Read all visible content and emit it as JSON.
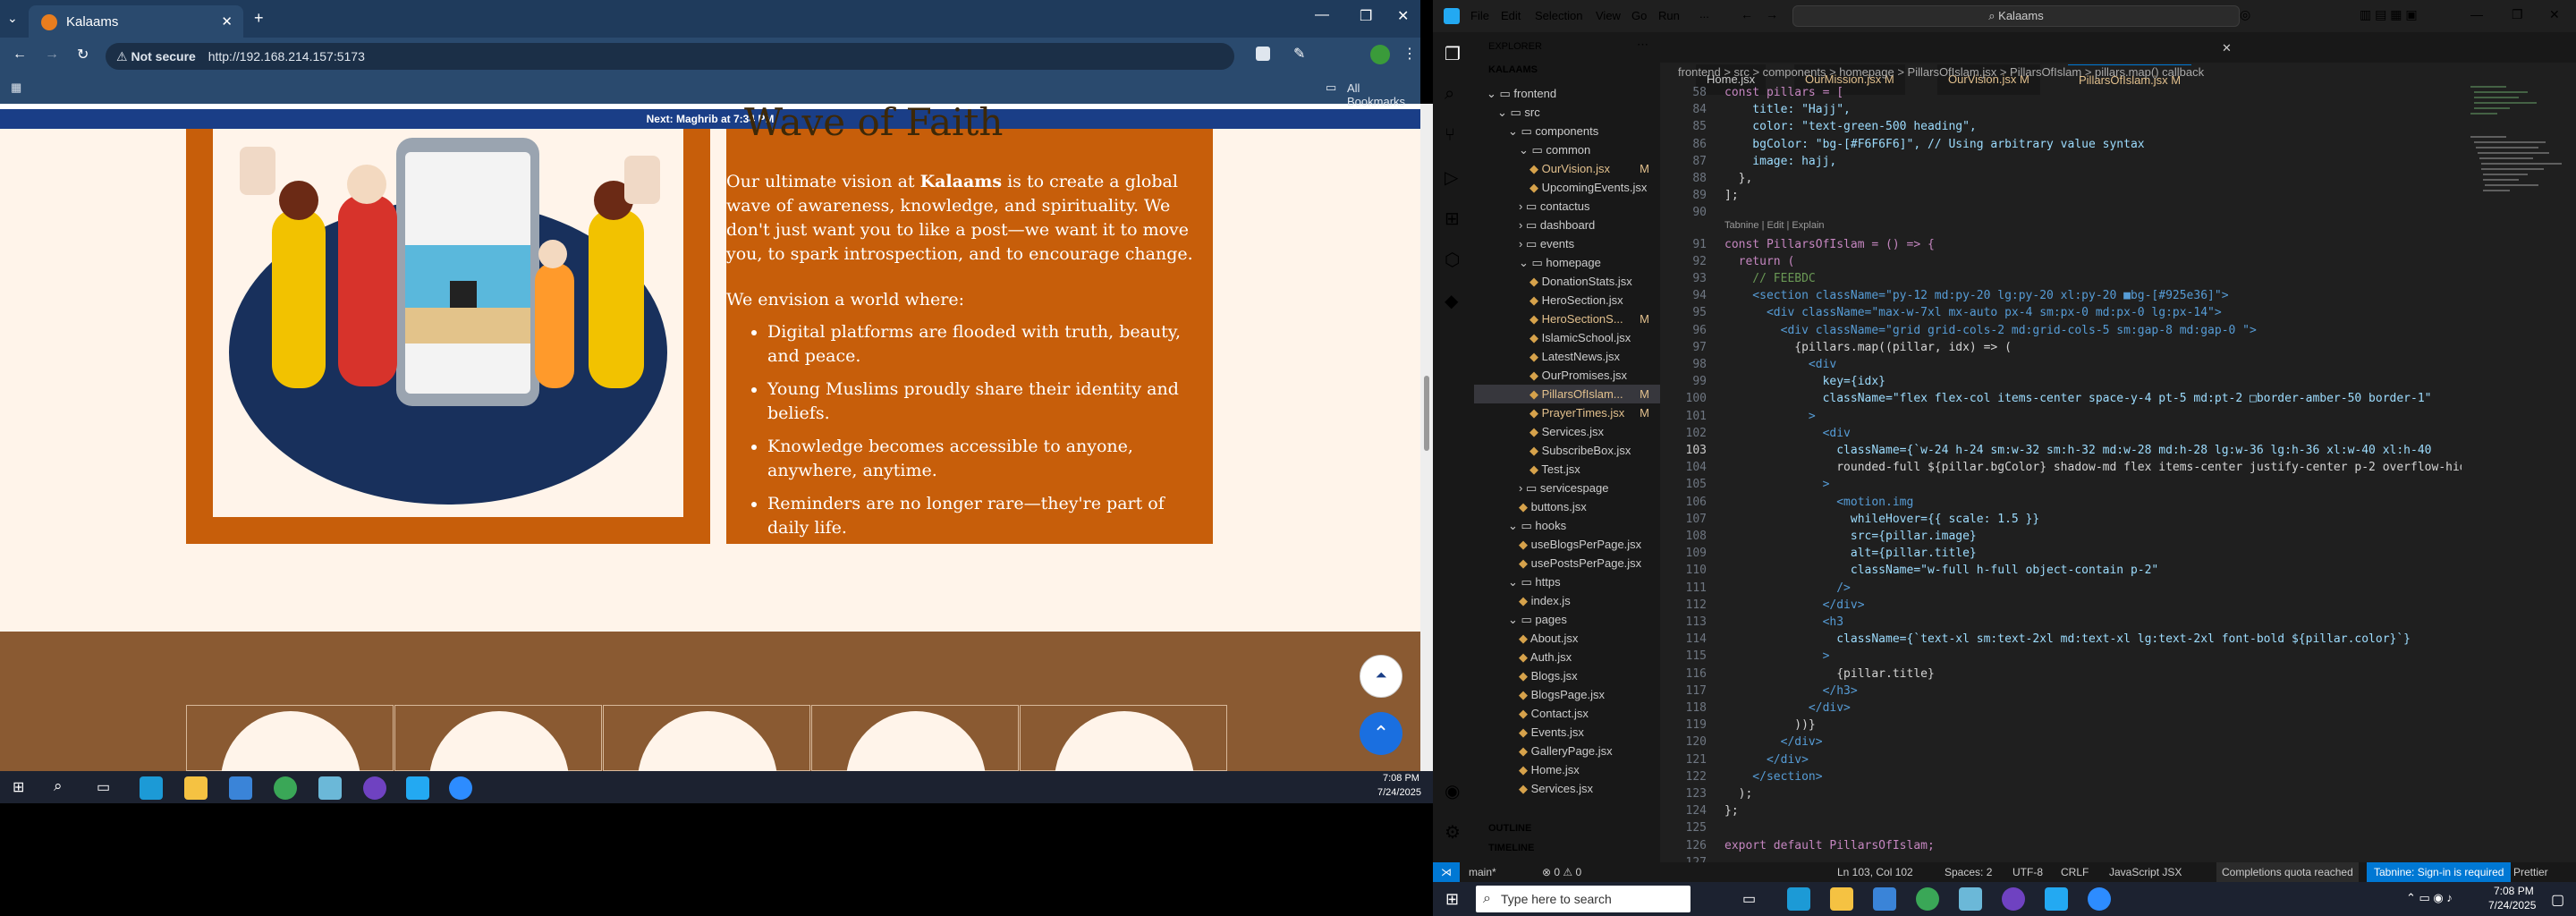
{
  "browser": {
    "tab_title": "Kalaams",
    "url_not_secure": "Not secure",
    "url": "http://192.168.214.157:5173",
    "all_bookmarks": "All Bookmarks",
    "next_prayer": "Next: Maghrib at 7:34 PM"
  },
  "site": {
    "heading_partial": "Wave of Faith",
    "para1_pre": "Our ultimate vision at ",
    "para1_brand": "Kalaams",
    "para1_post": " is to create a global wave of awareness, knowledge, and spirituality. We don't just want you to like a post—we want it to move you, to spark introspection, and to encourage change.",
    "para2": "We envision a world where:",
    "bullets": [
      "Digital platforms are flooded with truth, beauty, and peace.",
      "Young Muslims proudly share their identity and beliefs.",
      "Knowledge becomes accessible to anyone, anywhere, anytime.",
      "Reminders are no longer rare—they're part of daily life."
    ]
  },
  "taskbar_left": {
    "time": "7:08 PM",
    "date": "7/24/2025"
  },
  "vscode": {
    "menu": [
      "File",
      "Edit",
      "Selection",
      "View",
      "Go",
      "Run",
      "..."
    ],
    "search": "Kalaams",
    "explorer_title": "EXPLORER",
    "root": "KALAAMS",
    "tree": [
      {
        "label": "frontend",
        "indent": 0,
        "folder": true,
        "open": true
      },
      {
        "label": "src",
        "indent": 1,
        "folder": true,
        "open": true
      },
      {
        "label": "components",
        "indent": 2,
        "folder": true,
        "open": true
      },
      {
        "label": "common",
        "indent": 3,
        "folder": true,
        "open": true
      },
      {
        "label": "OurVision.jsx",
        "indent": 4,
        "folder": false,
        "badge": "M"
      },
      {
        "label": "UpcomingEvents.jsx",
        "indent": 4,
        "folder": false
      },
      {
        "label": "contactus",
        "indent": 3,
        "folder": true
      },
      {
        "label": "dashboard",
        "indent": 3,
        "folder": true
      },
      {
        "label": "events",
        "indent": 3,
        "folder": true
      },
      {
        "label": "homepage",
        "indent": 3,
        "folder": true,
        "open": true
      },
      {
        "label": "DonationStats.jsx",
        "indent": 4
      },
      {
        "label": "HeroSection.jsx",
        "indent": 4
      },
      {
        "label": "HeroSectionS...",
        "indent": 4,
        "badge": "M"
      },
      {
        "label": "IslamicSchool.jsx",
        "indent": 4
      },
      {
        "label": "LatestNews.jsx",
        "indent": 4
      },
      {
        "label": "OurPromises.jsx",
        "indent": 4
      },
      {
        "label": "PillarsOfIslam...",
        "indent": 4,
        "badge": "M",
        "selected": true
      },
      {
        "label": "PrayerTimes.jsx",
        "indent": 4,
        "badge": "M"
      },
      {
        "label": "Services.jsx",
        "indent": 4
      },
      {
        "label": "SubscribeBox.jsx",
        "indent": 4
      },
      {
        "label": "Test.jsx",
        "indent": 4
      },
      {
        "label": "servicespage",
        "indent": 3,
        "folder": true
      },
      {
        "label": "buttons.jsx",
        "indent": 3
      },
      {
        "label": "hooks",
        "indent": 2,
        "folder": true,
        "open": true
      },
      {
        "label": "useBlogsPerPage.jsx",
        "indent": 3
      },
      {
        "label": "usePostsPerPage.jsx",
        "indent": 3
      },
      {
        "label": "https",
        "indent": 2,
        "folder": true,
        "open": true
      },
      {
        "label": "index.js",
        "indent": 3
      },
      {
        "label": "pages",
        "indent": 2,
        "folder": true,
        "open": true
      },
      {
        "label": "About.jsx",
        "indent": 3
      },
      {
        "label": "Auth.jsx",
        "indent": 3
      },
      {
        "label": "Blogs.jsx",
        "indent": 3
      },
      {
        "label": "BlogsPage.jsx",
        "indent": 3
      },
      {
        "label": "Contact.jsx",
        "indent": 3
      },
      {
        "label": "Events.jsx",
        "indent": 3
      },
      {
        "label": "GalleryPage.jsx",
        "indent": 3
      },
      {
        "label": "Home.jsx",
        "indent": 3
      },
      {
        "label": "Services.jsx",
        "indent": 3
      }
    ],
    "outline": "OUTLINE",
    "timeline": "TIMELINE",
    "tabs": [
      {
        "label": "Home.jsx",
        "active": false
      },
      {
        "label": "OurMission.jsx M",
        "active": false
      },
      {
        "label": "OurVision.jsx M",
        "active": false
      },
      {
        "label": "PillarsOfIslam.jsx M",
        "active": true
      }
    ],
    "breadcrumb": "frontend > src > components > homepage > PillarsOfIslam.jsx > PillarsOfIslam > pillars.map() callback",
    "tabnine_hint": "Tabnine | Edit | Explain",
    "lines": [
      {
        "n": "58",
        "t": "const pillars = ["
      },
      {
        "n": "84",
        "t": "    title: \"Hajj\","
      },
      {
        "n": "85",
        "t": "    color: \"text-green-500 heading\","
      },
      {
        "n": "86",
        "t": "    bgColor: \"bg-[#F6F6F6]\", // Using arbitrary value syntax"
      },
      {
        "n": "87",
        "t": "    image: hajj,"
      },
      {
        "n": "88",
        "t": "  },"
      },
      {
        "n": "89",
        "t": "];"
      },
      {
        "n": "90",
        "t": ""
      },
      {
        "n": "91",
        "t": "const PillarsOfIslam = () => {"
      },
      {
        "n": "92",
        "t": "  return ("
      },
      {
        "n": "93",
        "t": "    // FEEBDC"
      },
      {
        "n": "94",
        "t": "    <section className=\"py-12 md:py-20 lg:py-20 xl:py-20 ■bg-[#925e36]\">"
      },
      {
        "n": "95",
        "t": "      <div className=\"max-w-7xl mx-auto px-4 sm:px-0 md:px-0 lg:px-14\">"
      },
      {
        "n": "96",
        "t": "        <div className=\"grid grid-cols-2 md:grid-cols-5 sm:gap-8 md:gap-0 \">"
      },
      {
        "n": "97",
        "t": "          {pillars.map((pillar, idx) => ("
      },
      {
        "n": "98",
        "t": "            <div"
      },
      {
        "n": "99",
        "t": "              key={idx}"
      },
      {
        "n": "100",
        "t": "              className=\"flex flex-col items-center space-y-4 pt-5 md:pt-2 □border-amber-50 border-1\""
      },
      {
        "n": "101",
        "t": "            >"
      },
      {
        "n": "102",
        "t": "              <div"
      },
      {
        "n": "103",
        "t": "                className={`w-24 h-24 sm:w-32 sm:h-32 md:w-28 md:h-28 lg:w-36 lg:h-36 xl:w-40 xl:h-40"
      },
      {
        "n": "104",
        "t": "                rounded-full ${pillar.bgColor} shadow-md flex items-center justify-center p-2 overflow-hidd"
      },
      {
        "n": "105",
        "t": "              >"
      },
      {
        "n": "106",
        "t": "                <motion.img"
      },
      {
        "n": "107",
        "t": "                  whileHover={{ scale: 1.5 }}"
      },
      {
        "n": "108",
        "t": "                  src={pillar.image}"
      },
      {
        "n": "109",
        "t": "                  alt={pillar.title}"
      },
      {
        "n": "110",
        "t": "                  className=\"w-full h-full object-contain p-2\""
      },
      {
        "n": "111",
        "t": "                />"
      },
      {
        "n": "112",
        "t": "              </div>"
      },
      {
        "n": "113",
        "t": "              <h3"
      },
      {
        "n": "114",
        "t": "                className={`text-xl sm:text-2xl md:text-xl lg:text-2xl font-bold ${pillar.color}`}"
      },
      {
        "n": "115",
        "t": "              >"
      },
      {
        "n": "116",
        "t": "                {pillar.title}"
      },
      {
        "n": "117",
        "t": "              </h3>"
      },
      {
        "n": "118",
        "t": "            </div>"
      },
      {
        "n": "119",
        "t": "          ))}"
      },
      {
        "n": "120",
        "t": "        </div>"
      },
      {
        "n": "121",
        "t": "      </div>"
      },
      {
        "n": "122",
        "t": "    </section>"
      },
      {
        "n": "123",
        "t": "  );"
      },
      {
        "n": "124",
        "t": "};"
      },
      {
        "n": "125",
        "t": ""
      },
      {
        "n": "126",
        "t": "export default PillarsOfIslam;"
      },
      {
        "n": "127",
        "t": ""
      }
    ],
    "status": {
      "branch": "main*",
      "errors": "0 ⚠ 0",
      "position": "Ln 103, Col 102",
      "spaces": "Spaces: 2",
      "encoding": "UTF-8",
      "eol": "CRLF",
      "language": "JavaScript JSX",
      "quota": "Completions quota reached",
      "tabnine": "Tabnine: Sign-in is required",
      "prettier": "Prettier"
    }
  },
  "taskbar_right": {
    "search_placeholder": "Type here to search",
    "time": "7:08 PM",
    "date": "7/24/2025"
  },
  "colors": {
    "orange_panel": "#c75e0a",
    "site_bg": "#fff4ea",
    "brown_section": "#8a5a32",
    "vs_bg": "#1f1f1f",
    "tabnine_blue": "#0078d4"
  }
}
